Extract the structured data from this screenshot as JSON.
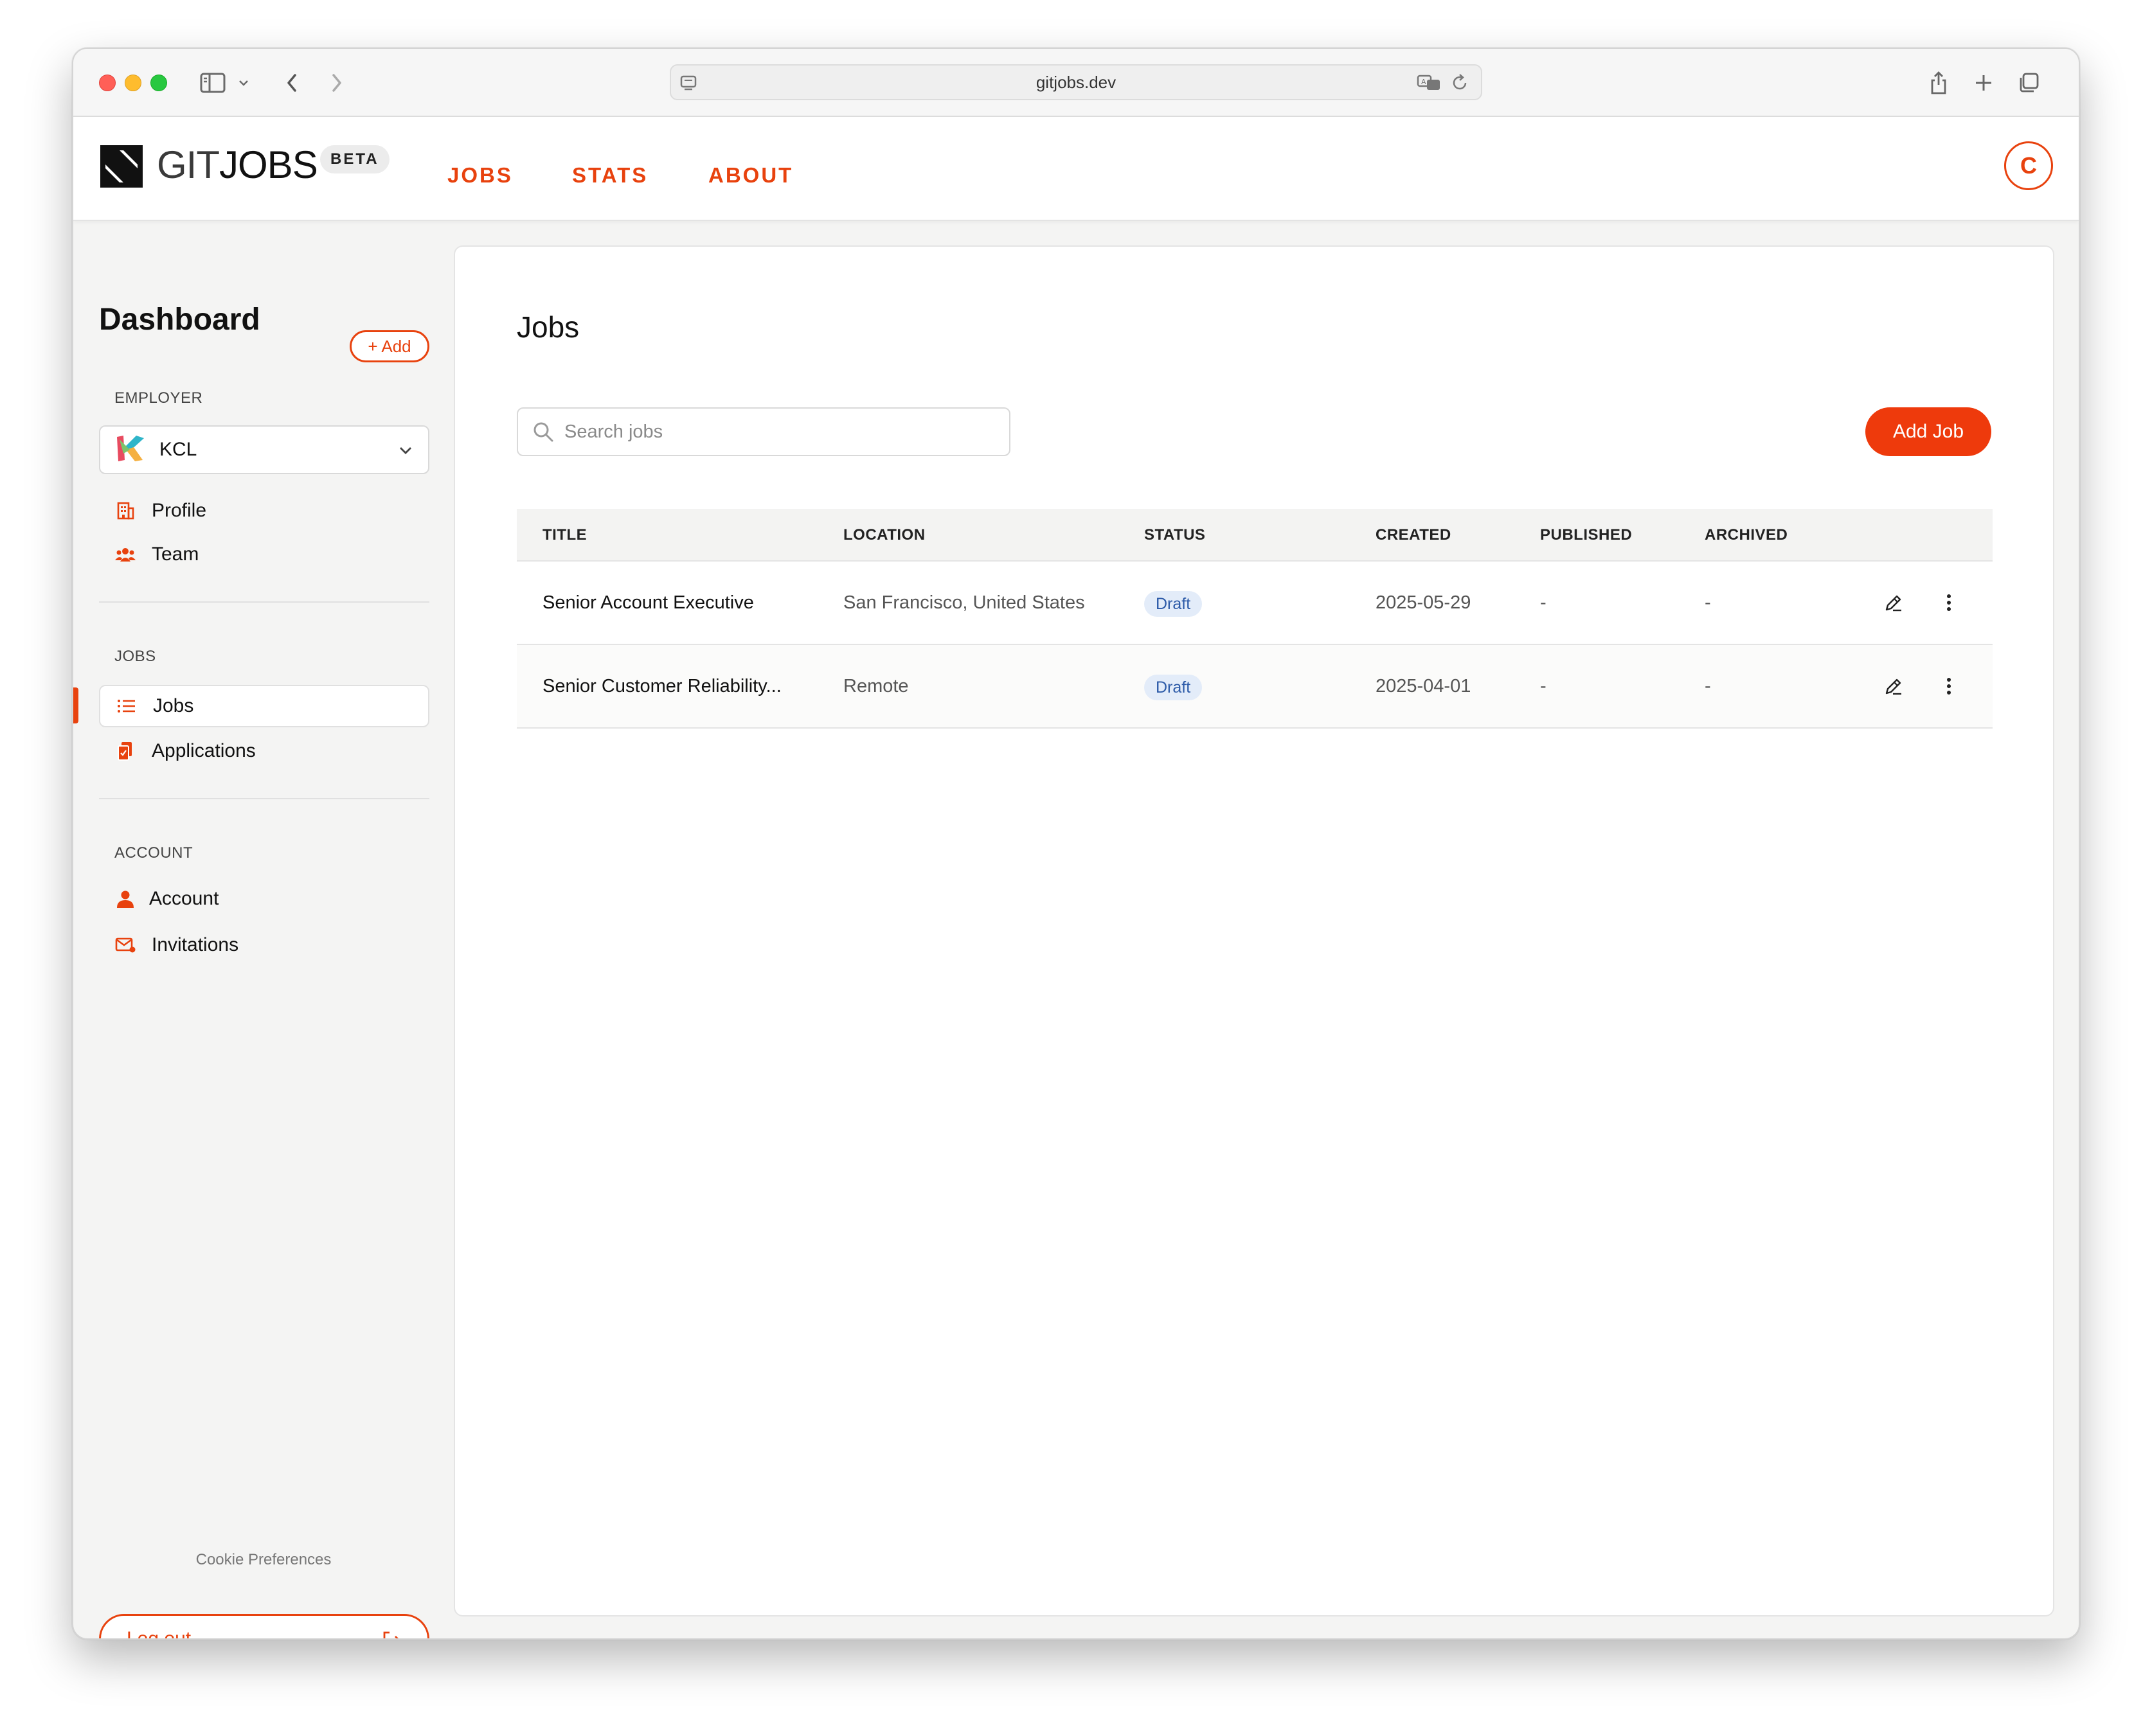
{
  "browser": {
    "url": "gitjobs.dev"
  },
  "header": {
    "logo_prefix": "GIT",
    "logo_suffix": "JOBS",
    "beta_badge": "BETA",
    "nav": [
      {
        "label": "JOBS"
      },
      {
        "label": "STATS"
      },
      {
        "label": "ABOUT"
      }
    ],
    "avatar_initial": "C"
  },
  "sidebar": {
    "title": "Dashboard",
    "employer_section": {
      "label": "EMPLOYER",
      "add_label": "+ Add",
      "selected_employer": "KCL",
      "items": [
        {
          "label": "Profile",
          "icon": "building-icon"
        },
        {
          "label": "Team",
          "icon": "users-icon"
        }
      ]
    },
    "jobs_section": {
      "label": "JOBS",
      "items": [
        {
          "label": "Jobs",
          "icon": "list-icon",
          "active": true
        },
        {
          "label": "Applications",
          "icon": "clipboard-icon"
        }
      ]
    },
    "account_section": {
      "label": "ACCOUNT",
      "items": [
        {
          "label": "Account",
          "icon": "user-icon"
        },
        {
          "label": "Invitations",
          "icon": "mail-icon"
        }
      ]
    },
    "cookie_preferences": "Cookie Preferences",
    "logout_label": "Log out"
  },
  "main": {
    "title": "Jobs",
    "search_placeholder": "Search jobs",
    "add_job_label": "Add Job",
    "table": {
      "columns": [
        "TITLE",
        "LOCATION",
        "STATUS",
        "CREATED",
        "PUBLISHED",
        "ARCHIVED"
      ],
      "rows": [
        {
          "title": "Senior Account Executive",
          "location": "San Francisco, United States",
          "status": "Draft",
          "created": "2025-05-29",
          "published": "-",
          "archived": "-"
        },
        {
          "title": "Senior Customer Reliability...",
          "location": "Remote",
          "status": "Draft",
          "created": "2025-04-01",
          "published": "-",
          "archived": "-"
        }
      ]
    }
  },
  "colors": {
    "accent": "#e8420e",
    "primary_button": "#ee3a0c",
    "badge_bg": "#e3ecf9",
    "badge_text": "#2c5aa8"
  }
}
